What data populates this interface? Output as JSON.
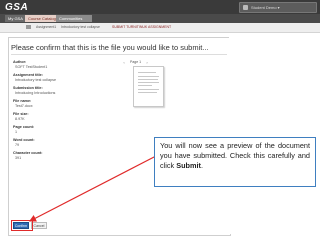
{
  "header": {
    "logo": "GSA",
    "user": "Student Demo ▾"
  },
  "nav": {
    "tabs": [
      {
        "label": "My GSA"
      },
      {
        "label": "Course Catalogues"
      },
      {
        "label": "Communities"
      }
    ]
  },
  "breadcrumb": [
    "Assignment1",
    "Introductory test collapse",
    "SUBMIT TURNITINUK ASSIGNMENT"
  ],
  "main": {
    "heading": "Please confirm that this is the file you would like to submit...",
    "fields": [
      {
        "label": "Author:",
        "value": "SOFT TestStudent1"
      },
      {
        "label": "Assignment title:",
        "value": "Introductory test collapse"
      },
      {
        "label": "Submission title:",
        "value": "Introducing Introductions"
      },
      {
        "label": "File name:",
        "value": "Test7.docx"
      },
      {
        "label": "File size:",
        "value": "8.97K"
      },
      {
        "label": "Page count:",
        "value": "1"
      },
      {
        "label": "Word count:",
        "value": "79"
      },
      {
        "label": "Character count:",
        "value": "391"
      }
    ],
    "preview": {
      "page_label": "Page 1"
    },
    "buttons": {
      "confirm": "Confirm",
      "cancel": "Cancel"
    }
  },
  "callout": {
    "text_before": "You will now see a preview of the document you have submitted. Check this carefully and click ",
    "bold": "Submit",
    "text_after": "."
  },
  "colors": {
    "callout_border": "#3f7fc0",
    "highlight": "#e02a2a",
    "submit_button": "#2f6ab3"
  }
}
